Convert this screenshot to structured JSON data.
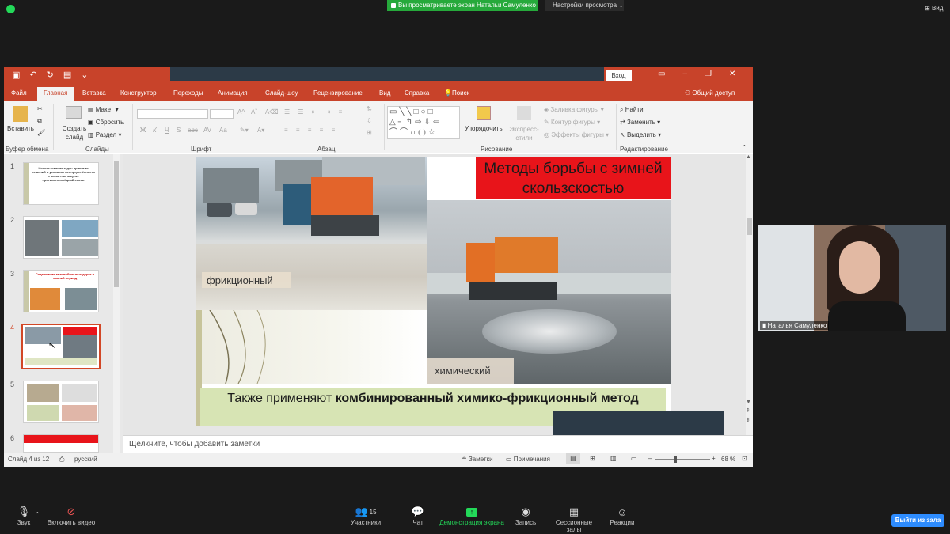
{
  "zoom": {
    "share_banner": "Вы просматриваете экран Натальи Самуленко",
    "view_settings": "Настройки просмотра",
    "view_label": "Вид",
    "participant_name": "Наталья Самуленко",
    "participants_count": "15",
    "toolbar": [
      {
        "id": "audio",
        "label": "Звук"
      },
      {
        "id": "video",
        "label": "Включить видео"
      },
      {
        "id": "participants",
        "label": "Участники"
      },
      {
        "id": "chat",
        "label": "Чат"
      },
      {
        "id": "share",
        "label": "Демонстрация экрана"
      },
      {
        "id": "record",
        "label": "Запись"
      },
      {
        "id": "rooms",
        "label": "Сессионные залы"
      },
      {
        "id": "reactions",
        "label": "Реакции"
      }
    ],
    "leave": "Выйти из зала",
    "accent": "#2d8cff",
    "share_green": "#26a93b"
  },
  "ppt": {
    "login_button": "Вход",
    "menu_tabs": [
      "Файл",
      "Главная",
      "Вставка",
      "Конструктор",
      "Переходы",
      "Анимация",
      "Слайд-шоу",
      "Рецензирование",
      "Вид",
      "Справка",
      "Поиск"
    ],
    "active_tab": "Главная",
    "share_access": "Общий доступ",
    "ribbon": {
      "paste": "Вставить",
      "clipboard": "Буфер обмена",
      "create_slide": "Создать слайд",
      "layout": "Макет",
      "reset": "Сбросить",
      "section": "Раздел",
      "slides_group": "Слайды",
      "font_group": "Шрифт",
      "paragraph_group": "Абзац",
      "arrange": "Упорядочить",
      "express_styles": "Экспресс-стили",
      "shape_fill": "Заливка фигуры",
      "shape_outline": "Контур фигуры",
      "shape_effects": "Эффекты фигуры",
      "drawing_group": "Рисование",
      "find": "Найти",
      "replace": "Заменить",
      "select": "Выделить",
      "editing_group": "Редактирование",
      "font_buttons": [
        "Ж",
        "К",
        "Ч",
        "S",
        "abc",
        "AV",
        "Aa"
      ]
    },
    "thumbnails": [
      {
        "num": "1",
        "text": "Использование задач принятия решений в условиях неопределённости и риска при закупке противогололёдной смеси"
      },
      {
        "num": "2",
        "text": ""
      },
      {
        "num": "3",
        "text": "Содержание автомобильных дорог в зимний период"
      },
      {
        "num": "4",
        "text": ""
      },
      {
        "num": "5",
        "text": ""
      },
      {
        "num": "6",
        "text": ""
      }
    ],
    "selected_thumbnail": "4",
    "slide": {
      "title": "Методы борьбы с зимней скользскостью",
      "label_friction": "фрикционный",
      "label_chemical": "химический",
      "bottom_normal": "Также применяют ",
      "bottom_bold": "комбинированный химико-фрикционный метод",
      "title_bg": "#e8141a"
    },
    "notes_placeholder": "Щелкните, чтобы добавить заметки",
    "status": {
      "slide_info": "Слайд 4 из 12",
      "language": "русский",
      "notes": "Заметки",
      "comments": "Примечания",
      "zoom": "68 %"
    },
    "accent": "#c8432a"
  }
}
